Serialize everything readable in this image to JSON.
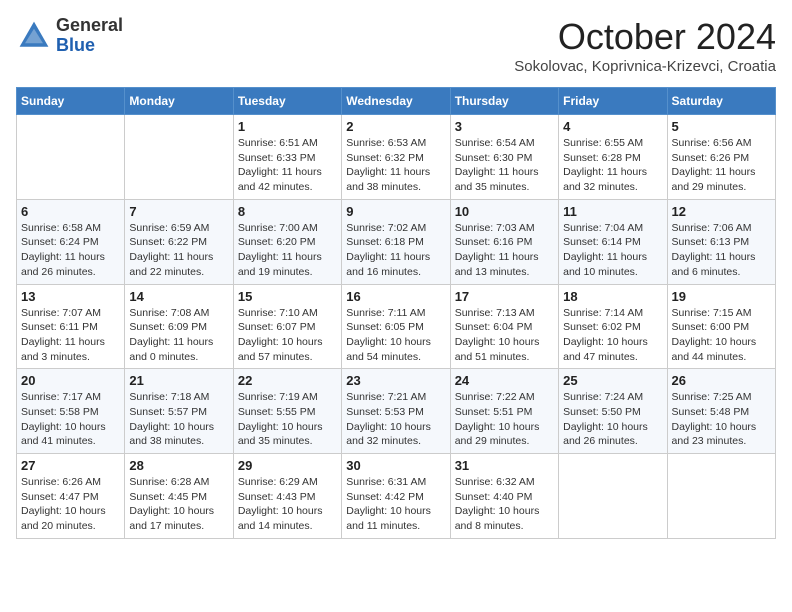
{
  "header": {
    "logo_general": "General",
    "logo_blue": "Blue",
    "month_title": "October 2024",
    "subtitle": "Sokolovac, Koprivnica-Krizevci, Croatia"
  },
  "weekdays": [
    "Sunday",
    "Monday",
    "Tuesday",
    "Wednesday",
    "Thursday",
    "Friday",
    "Saturday"
  ],
  "weeks": [
    [
      {
        "day": "",
        "info": ""
      },
      {
        "day": "",
        "info": ""
      },
      {
        "day": "1",
        "info": "Sunrise: 6:51 AM\nSunset: 6:33 PM\nDaylight: 11 hours and 42 minutes."
      },
      {
        "day": "2",
        "info": "Sunrise: 6:53 AM\nSunset: 6:32 PM\nDaylight: 11 hours and 38 minutes."
      },
      {
        "day": "3",
        "info": "Sunrise: 6:54 AM\nSunset: 6:30 PM\nDaylight: 11 hours and 35 minutes."
      },
      {
        "day": "4",
        "info": "Sunrise: 6:55 AM\nSunset: 6:28 PM\nDaylight: 11 hours and 32 minutes."
      },
      {
        "day": "5",
        "info": "Sunrise: 6:56 AM\nSunset: 6:26 PM\nDaylight: 11 hours and 29 minutes."
      }
    ],
    [
      {
        "day": "6",
        "info": "Sunrise: 6:58 AM\nSunset: 6:24 PM\nDaylight: 11 hours and 26 minutes."
      },
      {
        "day": "7",
        "info": "Sunrise: 6:59 AM\nSunset: 6:22 PM\nDaylight: 11 hours and 22 minutes."
      },
      {
        "day": "8",
        "info": "Sunrise: 7:00 AM\nSunset: 6:20 PM\nDaylight: 11 hours and 19 minutes."
      },
      {
        "day": "9",
        "info": "Sunrise: 7:02 AM\nSunset: 6:18 PM\nDaylight: 11 hours and 16 minutes."
      },
      {
        "day": "10",
        "info": "Sunrise: 7:03 AM\nSunset: 6:16 PM\nDaylight: 11 hours and 13 minutes."
      },
      {
        "day": "11",
        "info": "Sunrise: 7:04 AM\nSunset: 6:14 PM\nDaylight: 11 hours and 10 minutes."
      },
      {
        "day": "12",
        "info": "Sunrise: 7:06 AM\nSunset: 6:13 PM\nDaylight: 11 hours and 6 minutes."
      }
    ],
    [
      {
        "day": "13",
        "info": "Sunrise: 7:07 AM\nSunset: 6:11 PM\nDaylight: 11 hours and 3 minutes."
      },
      {
        "day": "14",
        "info": "Sunrise: 7:08 AM\nSunset: 6:09 PM\nDaylight: 11 hours and 0 minutes."
      },
      {
        "day": "15",
        "info": "Sunrise: 7:10 AM\nSunset: 6:07 PM\nDaylight: 10 hours and 57 minutes."
      },
      {
        "day": "16",
        "info": "Sunrise: 7:11 AM\nSunset: 6:05 PM\nDaylight: 10 hours and 54 minutes."
      },
      {
        "day": "17",
        "info": "Sunrise: 7:13 AM\nSunset: 6:04 PM\nDaylight: 10 hours and 51 minutes."
      },
      {
        "day": "18",
        "info": "Sunrise: 7:14 AM\nSunset: 6:02 PM\nDaylight: 10 hours and 47 minutes."
      },
      {
        "day": "19",
        "info": "Sunrise: 7:15 AM\nSunset: 6:00 PM\nDaylight: 10 hours and 44 minutes."
      }
    ],
    [
      {
        "day": "20",
        "info": "Sunrise: 7:17 AM\nSunset: 5:58 PM\nDaylight: 10 hours and 41 minutes."
      },
      {
        "day": "21",
        "info": "Sunrise: 7:18 AM\nSunset: 5:57 PM\nDaylight: 10 hours and 38 minutes."
      },
      {
        "day": "22",
        "info": "Sunrise: 7:19 AM\nSunset: 5:55 PM\nDaylight: 10 hours and 35 minutes."
      },
      {
        "day": "23",
        "info": "Sunrise: 7:21 AM\nSunset: 5:53 PM\nDaylight: 10 hours and 32 minutes."
      },
      {
        "day": "24",
        "info": "Sunrise: 7:22 AM\nSunset: 5:51 PM\nDaylight: 10 hours and 29 minutes."
      },
      {
        "day": "25",
        "info": "Sunrise: 7:24 AM\nSunset: 5:50 PM\nDaylight: 10 hours and 26 minutes."
      },
      {
        "day": "26",
        "info": "Sunrise: 7:25 AM\nSunset: 5:48 PM\nDaylight: 10 hours and 23 minutes."
      }
    ],
    [
      {
        "day": "27",
        "info": "Sunrise: 6:26 AM\nSunset: 4:47 PM\nDaylight: 10 hours and 20 minutes."
      },
      {
        "day": "28",
        "info": "Sunrise: 6:28 AM\nSunset: 4:45 PM\nDaylight: 10 hours and 17 minutes."
      },
      {
        "day": "29",
        "info": "Sunrise: 6:29 AM\nSunset: 4:43 PM\nDaylight: 10 hours and 14 minutes."
      },
      {
        "day": "30",
        "info": "Sunrise: 6:31 AM\nSunset: 4:42 PM\nDaylight: 10 hours and 11 minutes."
      },
      {
        "day": "31",
        "info": "Sunrise: 6:32 AM\nSunset: 4:40 PM\nDaylight: 10 hours and 8 minutes."
      },
      {
        "day": "",
        "info": ""
      },
      {
        "day": "",
        "info": ""
      }
    ]
  ]
}
